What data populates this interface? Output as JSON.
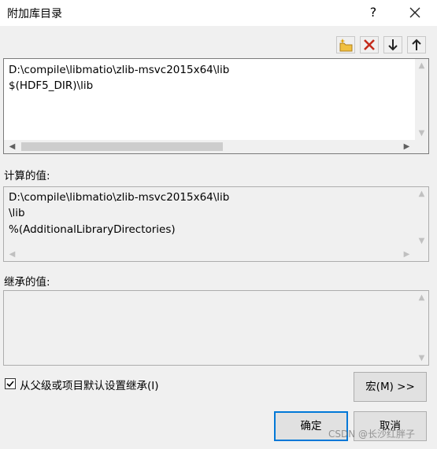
{
  "window": {
    "title": "附加库目录",
    "help_label": "?"
  },
  "toolbar": {
    "buttons": [
      "new-line-icon",
      "delete-icon",
      "move-down-icon",
      "move-up-icon"
    ],
    "colors": {
      "delete": "#c42b1c",
      "folder": "#f0c040"
    }
  },
  "editor": {
    "lines": [
      "D:\\compile\\libmatio\\zlib-msvc2015x64\\lib",
      "$(HDF5_DIR)\\lib"
    ]
  },
  "evaluated": {
    "label": "计算的值:",
    "lines": [
      "D:\\compile\\libmatio\\zlib-msvc2015x64\\lib",
      "\\lib",
      "%(AdditionalLibraryDirectories)"
    ]
  },
  "inherited": {
    "label": "继承的值:",
    "lines": []
  },
  "inherit_checkbox": {
    "label": "从父级或项目默认设置继承(I)",
    "checked": true
  },
  "buttons": {
    "macros": "宏(M) >>",
    "ok": "确定",
    "cancel": "取消"
  },
  "watermark": "CSDN @长沙红胖子",
  "accent_color": "#0078d7"
}
